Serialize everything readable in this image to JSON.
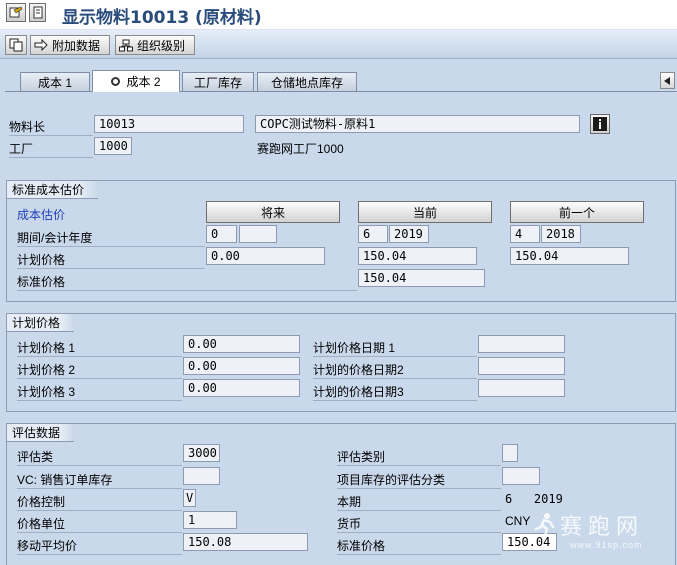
{
  "window": {
    "title": "显示物料10013 (原材料)"
  },
  "toolbar": {
    "additional_data": "附加数据",
    "org_levels": "组织级别"
  },
  "tabs": [
    {
      "label": "成本 1",
      "active": false
    },
    {
      "label": "成本 2",
      "active": true
    },
    {
      "label": "工厂库存",
      "active": false
    },
    {
      "label": "仓储地点库存",
      "active": false
    }
  ],
  "header": {
    "material_label": "物料长",
    "material_value": "10013",
    "material_desc": "COPC测试物料-原料1",
    "plant_label": "工厂",
    "plant_value": "1000",
    "plant_desc": "赛跑网工厂1000"
  },
  "std_cost": {
    "title": "标准成本估价",
    "cost_estimate_label": "成本估价",
    "btn_future": "将来",
    "btn_current": "当前",
    "btn_previous": "前一个",
    "period_label": "期间/会计年度",
    "planned_price_label": "计划价格",
    "standard_price_label": "标准价格",
    "future": {
      "period": "0",
      "year": "",
      "planned_price": "0.00"
    },
    "current": {
      "period": "6",
      "year": "2019",
      "planned_price": "150.04",
      "standard_price": "150.04"
    },
    "previous": {
      "period": "4",
      "year": "2018",
      "planned_price": "150.04"
    }
  },
  "planned_prices": {
    "title": "计划价格",
    "price1_label": "计划价格 1",
    "price1_value": "0.00",
    "price2_label": "计划价格 2",
    "price2_value": "0.00",
    "price3_label": "计划价格 3",
    "price3_value": "0.00",
    "date1_label": "计划价格日期 1",
    "date1_value": "",
    "date2_label": "计划的价格日期2",
    "date2_value": "",
    "date3_label": "计划的价格日期3",
    "date3_value": ""
  },
  "valuation": {
    "title": "评估数据",
    "valuation_class_label": "评估类",
    "valuation_class_value": "3000",
    "vc_sales_label": "VC: 销售订单库存",
    "vc_sales_value": "",
    "price_control_label": "价格控制",
    "price_control_value": "V",
    "price_unit_label": "价格单位",
    "price_unit_value": "1",
    "moving_avg_label": "移动平均价",
    "moving_avg_value": "150.08",
    "valuation_category_label": "评估类别",
    "valuation_category_value": "",
    "project_stock_label": "项目库存的评估分类",
    "project_stock_value": "",
    "current_period_label": "本期",
    "current_period_value": "6   2019",
    "currency_label": "货币",
    "currency_value": "CNY",
    "standard_price_label": "标准价格",
    "standard_price_value": "150.04"
  },
  "watermark": {
    "text": "赛跑网",
    "url": "www.91sp.com"
  }
}
